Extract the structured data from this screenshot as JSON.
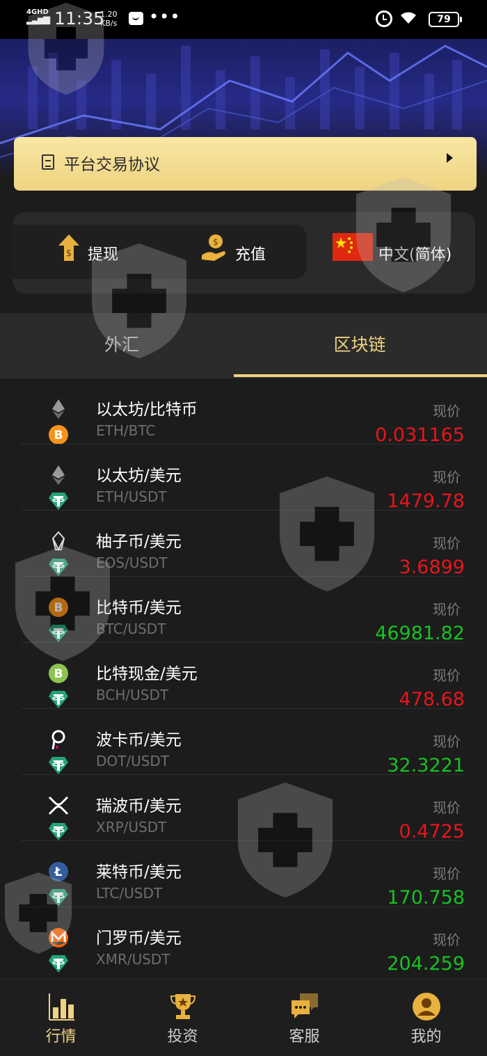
{
  "status_bar": {
    "network": "4GHD",
    "time": "11:35",
    "speed_value": "1.20",
    "speed_unit": "KB/s",
    "more": "•••",
    "battery": "79"
  },
  "agreement": {
    "label": "平台交易协议"
  },
  "actions": {
    "withdraw": "提现",
    "deposit": "充值",
    "language": "中文(简体)"
  },
  "tabs": [
    {
      "label": "外汇",
      "active": false
    },
    {
      "label": "区块链",
      "active": true
    }
  ],
  "market": {
    "price_label": "现价",
    "rows": [
      {
        "name": "以太坊/比特币",
        "pair": "ETH/BTC",
        "price": "0.031165",
        "trend": "down",
        "base_icon": "eth-icon",
        "quote_icon": "btc-icon"
      },
      {
        "name": "以太坊/美元",
        "pair": "ETH/USDT",
        "price": "1479.78",
        "trend": "down",
        "base_icon": "eth-icon",
        "quote_icon": "usdt-icon"
      },
      {
        "name": "柚子币/美元",
        "pair": "EOS/USDT",
        "price": "3.6899",
        "trend": "down",
        "base_icon": "eos-icon",
        "quote_icon": "usdt-icon"
      },
      {
        "name": "比特币/美元",
        "pair": "BTC/USDT",
        "price": "46981.82",
        "trend": "up",
        "base_icon": "btc-icon",
        "quote_icon": "usdt-icon"
      },
      {
        "name": "比特现金/美元",
        "pair": "BCH/USDT",
        "price": "478.68",
        "trend": "down",
        "base_icon": "bch-icon",
        "quote_icon": "usdt-icon"
      },
      {
        "name": "波卡币/美元",
        "pair": "DOT/USDT",
        "price": "32.3221",
        "trend": "up",
        "base_icon": "dot-icon",
        "quote_icon": "usdt-icon"
      },
      {
        "name": "瑞波币/美元",
        "pair": "XRP/USDT",
        "price": "0.4725",
        "trend": "down",
        "base_icon": "xrp-icon",
        "quote_icon": "usdt-icon"
      },
      {
        "name": "莱特币/美元",
        "pair": "LTC/USDT",
        "price": "170.758",
        "trend": "up",
        "base_icon": "ltc-icon",
        "quote_icon": "usdt-icon"
      },
      {
        "name": "门罗币/美元",
        "pair": "XMR/USDT",
        "price": "204.259",
        "trend": "up",
        "base_icon": "xmr-icon",
        "quote_icon": "usdt-icon"
      }
    ]
  },
  "colors": {
    "accent_gold": "#efd382",
    "price_down": "#e8151b",
    "price_up": "#17c221",
    "background": "#1c1c1c"
  },
  "bottom_nav": [
    {
      "label": "行情",
      "icon": "bar-chart-icon",
      "active": true
    },
    {
      "label": "投资",
      "icon": "trophy-icon",
      "active": false
    },
    {
      "label": "客服",
      "icon": "chat-icon",
      "active": false
    },
    {
      "label": "我的",
      "icon": "user-icon",
      "active": false
    }
  ]
}
